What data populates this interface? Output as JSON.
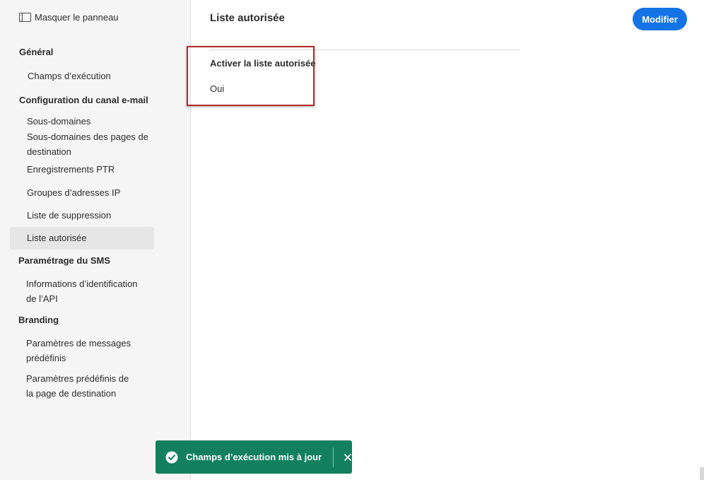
{
  "sidebar": {
    "hide_panel_label": "Masquer le panneau",
    "sections": [
      {
        "title": "Général",
        "items": [
          "Champs d’exécution"
        ]
      },
      {
        "title": "Configuration du canal e-mail",
        "items": [
          "Sous-domaines",
          "Sous-domaines des pages de destination",
          "Enregistrements PTR",
          "Groupes d’adresses IP",
          "Liste de suppression",
          "Liste autorisée"
        ]
      },
      {
        "title": "Paramétrage du SMS",
        "items": [
          "Informations d’identification de l’API"
        ]
      },
      {
        "title": "Branding",
        "items": [
          "Paramètres de messages prédéfinis",
          "Paramètres prédéfinis de la page de destination"
        ]
      }
    ],
    "selected_item": "Liste autorisée"
  },
  "main": {
    "title": "Liste autorisée",
    "modify_button": "Modifier",
    "field": {
      "label": "Activer la liste autorisée",
      "value": "Oui"
    }
  },
  "toast": {
    "message": "Champs d’exécution mis à jour",
    "status": "success"
  },
  "colors": {
    "accent": "#1473e6",
    "toast_bg": "#12805c",
    "highlight": "#b3292a"
  }
}
